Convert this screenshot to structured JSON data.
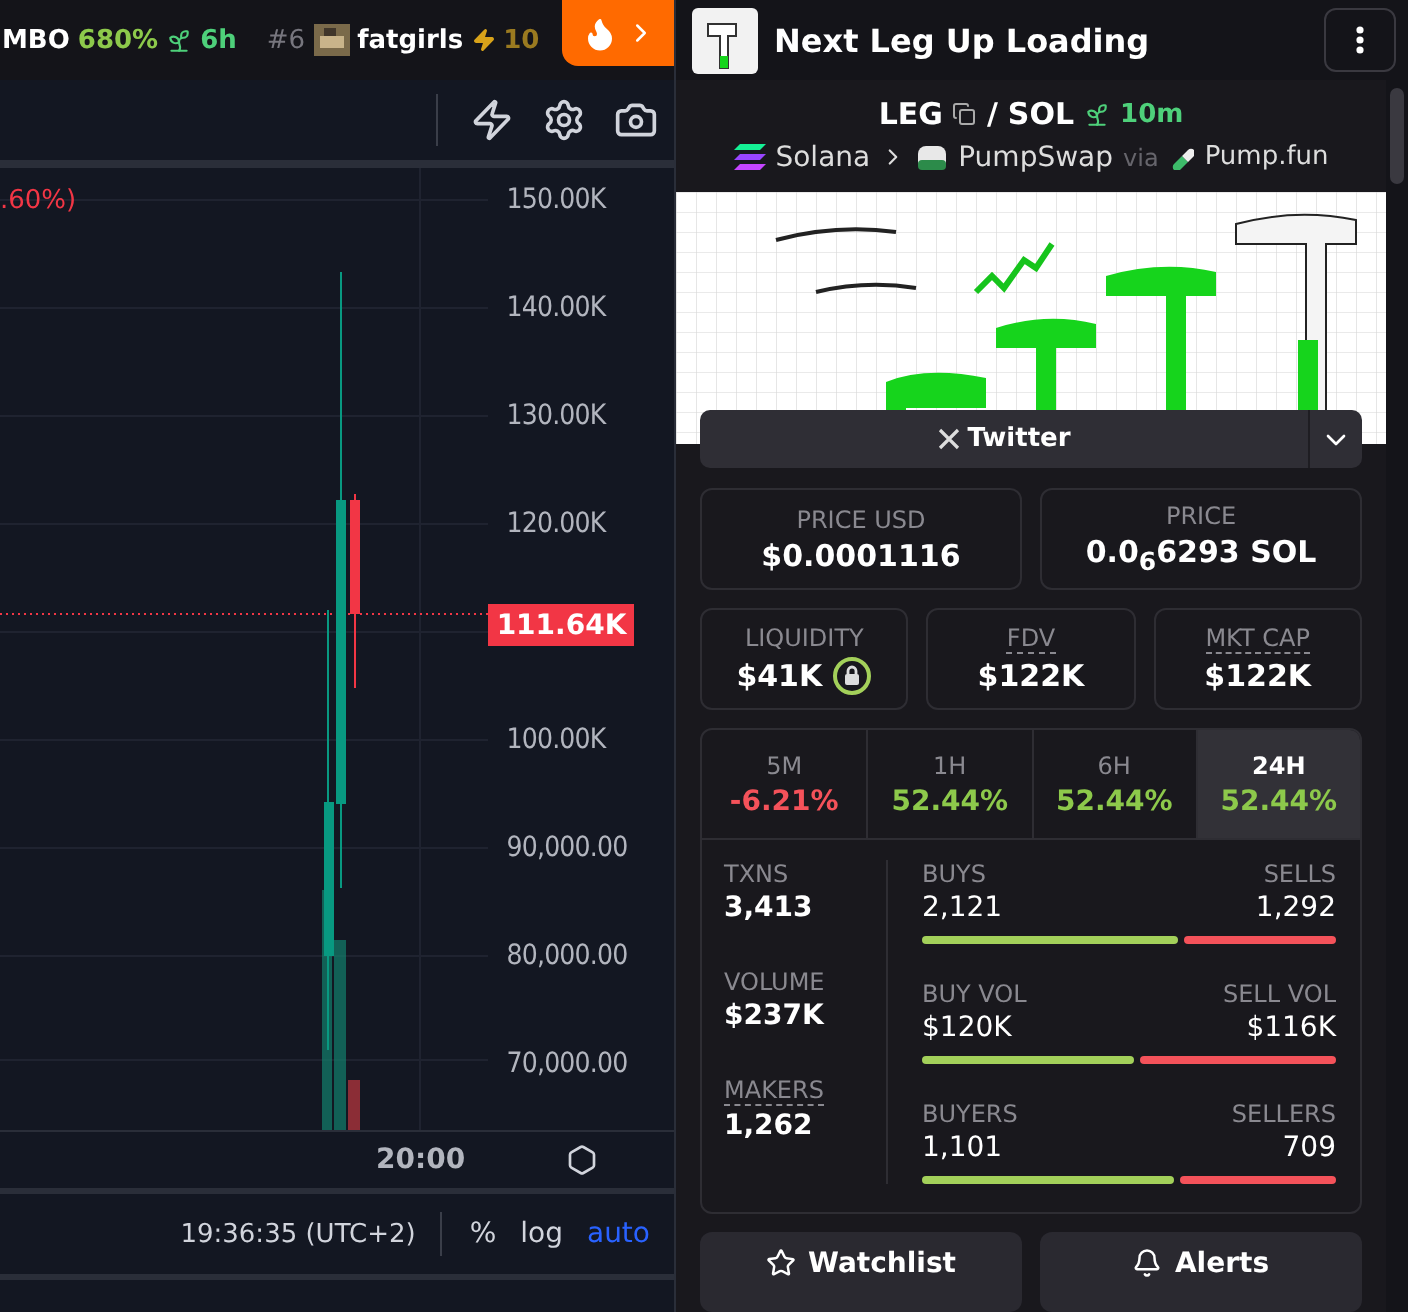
{
  "ticker": {
    "items": [
      {
        "symbol": "MBO",
        "change": "680%",
        "age": "6h"
      }
    ],
    "trending": {
      "rank": "#6",
      "name": "fatgirls",
      "boosts": "10"
    }
  },
  "chart": {
    "change_label": ".60%)",
    "price_axis": [
      {
        "label": "150.00K",
        "kind": "tick"
      },
      {
        "label": "140.00K",
        "kind": "tick"
      },
      {
        "label": "130.00K",
        "kind": "tick"
      },
      {
        "label": "120.00K",
        "kind": "tick"
      },
      {
        "label": "111.64K",
        "kind": "current"
      },
      {
        "label": "100.00K",
        "kind": "tick"
      },
      {
        "label": "90,000.00",
        "kind": "tick"
      },
      {
        "label": "80,000.00",
        "kind": "tick"
      },
      {
        "label": "70,000.00",
        "kind": "tick"
      }
    ],
    "time_label": "20:00",
    "clock": "19:36:35 (UTC+2)",
    "scale_options": [
      {
        "label": "%",
        "selected": false
      },
      {
        "label": "log",
        "selected": false
      },
      {
        "label": "auto",
        "selected": true
      }
    ]
  },
  "token": {
    "title": "Next Leg Up Loading",
    "base": "LEG",
    "separator": "/",
    "quote": "SOL",
    "age": "10m",
    "chain": "Solana",
    "dex": "PumpSwap",
    "via": "via",
    "launchpad": "Pump.fun",
    "social": "Twitter"
  },
  "prices": [
    {
      "label": "PRICE USD",
      "value": "$0.0001116"
    },
    {
      "label": "PRICE",
      "value": "0.0$_{6}$6293 SOL"
    }
  ],
  "metrics": [
    {
      "label": "LIQUIDITY",
      "value": "$41K",
      "locked": true,
      "dotted": false
    },
    {
      "label": "FDV",
      "value": "$122K",
      "locked": false,
      "dotted": true
    },
    {
      "label": "MKT CAP",
      "value": "$122K",
      "locked": false,
      "dotted": true
    }
  ],
  "periods": [
    {
      "label": "5M",
      "change": "-6.21%",
      "color": "#f4525a",
      "selected": false
    },
    {
      "label": "1H",
      "change": "52.44%",
      "color": "#8dc94b",
      "selected": false
    },
    {
      "label": "6H",
      "change": "52.44%",
      "color": "#8dc94b",
      "selected": false
    },
    {
      "label": "24H",
      "change": "52.44%",
      "color": "#8dc94b",
      "selected": true
    }
  ],
  "totals": [
    {
      "label": "TXNS",
      "value": "3,413",
      "dotted": false
    },
    {
      "label": "VOLUME",
      "value": "$237K",
      "dotted": false
    },
    {
      "label": "MAKERS",
      "value": "1,262",
      "dotted": true
    }
  ],
  "splits": [
    {
      "left_label": "BUYS",
      "left_value": "2,121",
      "right_label": "SELLS",
      "right_value": "1,292",
      "level": 0.62
    },
    {
      "left_label": "BUY VOL",
      "left_value": "$120K",
      "right_label": "SELL VOL",
      "right_value": "$116K",
      "level": 0.51
    },
    {
      "left_label": "BUYERS",
      "left_value": "1,101",
      "right_label": "SELLERS",
      "right_value": "709",
      "level": 0.61
    }
  ],
  "actions": [
    {
      "label": "Watchlist",
      "kind": "star"
    },
    {
      "label": "Alerts",
      "kind": "bell"
    }
  ]
}
